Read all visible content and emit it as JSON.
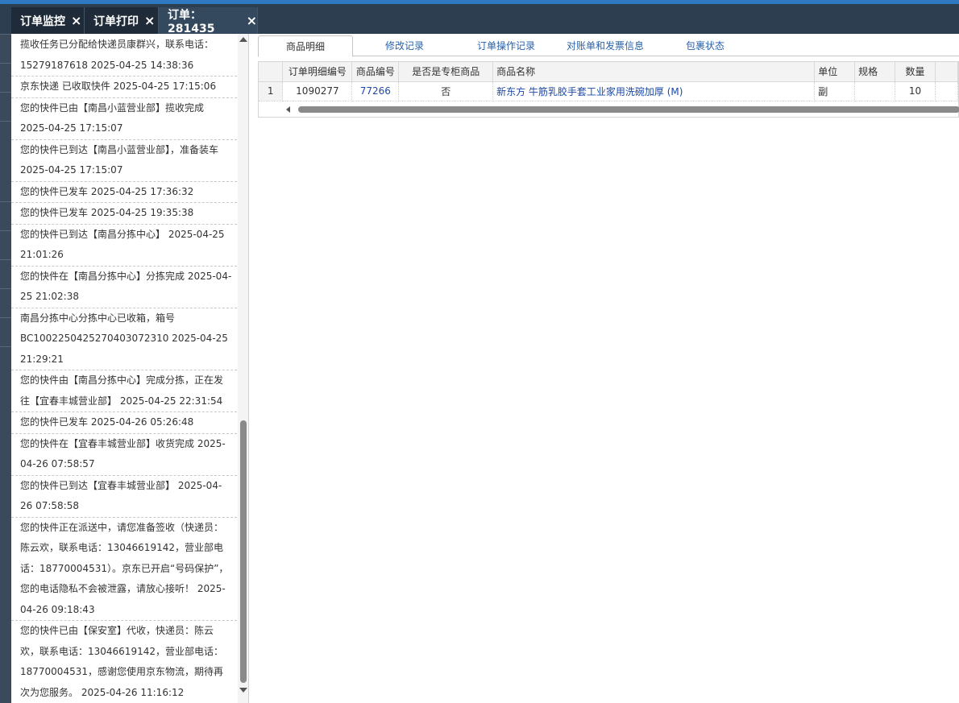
{
  "tabs": [
    {
      "label": "订单监控",
      "close": "×"
    },
    {
      "label": "订单打印",
      "close": "×"
    },
    {
      "label": "订单：281435",
      "close": "×"
    }
  ],
  "tracking": [
    "揽收任务已分配给快递员康群兴，联系电话：15279187618 2025-04-25 14:38:36",
    "京东快递 已收取快件 2025-04-25 17:15:06",
    "您的快件已由【南昌小蓝营业部】揽收完成 2025-04-25 17:15:07",
    "您的快件已到达【南昌小蓝营业部】，准备装车 2025-04-25 17:15:07",
    "您的快件已发车 2025-04-25 17:36:32",
    "您的快件已发车 2025-04-25 19:35:38",
    "您的快件已到达【南昌分拣中心】 2025-04-25 21:01:26",
    "您的快件在【南昌分拣中心】分拣完成 2025-04-25 21:02:38",
    "南昌分拣中心分拣中心已收箱，箱号BC1002250425270403072310 2025-04-25 21:29:21",
    "您的快件由【南昌分拣中心】完成分拣，正在发往【宜春丰城营业部】 2025-04-25 22:31:54",
    "您的快件已发车 2025-04-26 05:26:48",
    "您的快件在【宜春丰城营业部】收货完成 2025-04-26 07:58:57",
    "您的快件已到达【宜春丰城营业部】 2025-04-26 07:58:58",
    "您的快件正在派送中，请您准备签收（快递员：陈云欢，联系电话：13046619142，营业部电话：18770004531）。京东已开启“号码保护”，您的电话隐私不会被泄露，请放心接听！ 2025-04-26 09:18:43",
    "您的快件已由【保安室】代收，快递员：陈云欢，联系电话：13046619142，营业部电话：18770004531，感谢您使用京东物流，期待再次为您服务。 2025-04-26 11:16:12"
  ],
  "subtabs": [
    "商品明细",
    "修改记录",
    "订单操作记录",
    "对账单和发票信息",
    "包裹状态"
  ],
  "grid": {
    "headers": [
      "订单明细编号",
      "商品编号",
      "是否是专柜商品",
      "商品名称",
      "单位",
      "规格",
      "数量"
    ],
    "rows": [
      {
        "rownum": "1",
        "detail_id": "1090277",
        "product_id": "77266",
        "counter": "否",
        "name": "新东方 牛筋乳胶手套工业家用洗碗加厚 (M)",
        "unit": "副",
        "spec": "",
        "qty": "10"
      }
    ]
  }
}
